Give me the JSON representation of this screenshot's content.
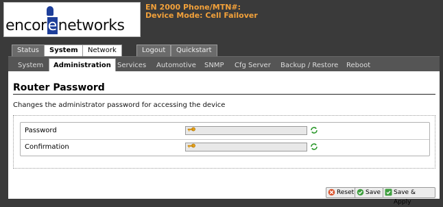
{
  "brand": {
    "logo_text_before": "encor",
    "logo_text_e": "e",
    "logo_text_after": "networks"
  },
  "device": {
    "line1": "EN 2000 Phone/MTN#:",
    "line2": "Device Mode: Cell Failover"
  },
  "main_tabs": [
    {
      "label": "Status"
    },
    {
      "label": "System"
    },
    {
      "label": "Network"
    },
    {
      "label": "Logout"
    },
    {
      "label": "Quickstart"
    }
  ],
  "sub_tabs": [
    {
      "label": "System"
    },
    {
      "label": "Administration"
    },
    {
      "label": "Services"
    },
    {
      "label": "Automotive"
    },
    {
      "label": "SNMP"
    },
    {
      "label": "Cfg Server"
    },
    {
      "label": "Backup / Restore"
    },
    {
      "label": "Reboot"
    }
  ],
  "page": {
    "title": "Router Password",
    "description": "Changes the administrator password for accessing the device"
  },
  "fields": [
    {
      "label": "Password",
      "value": ""
    },
    {
      "label": "Confirmation",
      "value": ""
    }
  ],
  "buttons": {
    "reset": "Reset",
    "save": "Save",
    "save_apply": "Save & Apply"
  },
  "colors": {
    "background": "#3a3a3a",
    "device_info": "#f2a13a",
    "logo_blue": "#1e3f9a"
  }
}
